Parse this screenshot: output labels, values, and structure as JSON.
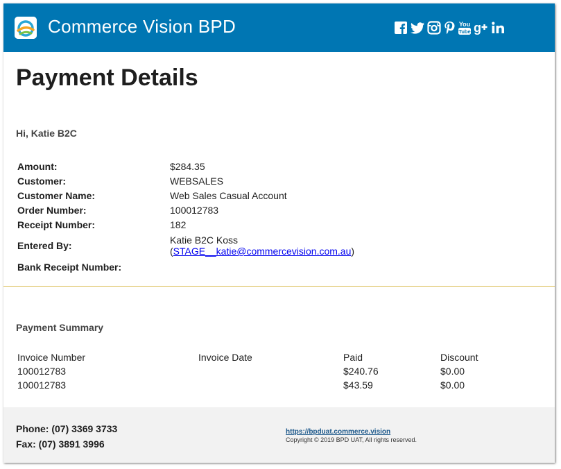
{
  "header": {
    "brand": "Commerce Vision BPD",
    "background": "#0076b3",
    "social_icons": [
      "facebook-icon",
      "twitter-icon",
      "instagram-icon",
      "pinterest-icon",
      "youtube-icon",
      "google-plus-icon",
      "linkedin-icon"
    ]
  },
  "page": {
    "title": "Payment Details",
    "greeting": "Hi, Katie B2C"
  },
  "details": {
    "amount_label": "Amount:",
    "amount_value": "$284.35",
    "customer_label": "Customer:",
    "customer_value": "WEBSALES",
    "customer_name_label": "Customer Name:",
    "customer_name_value": "Web Sales Casual Account",
    "order_number_label": "Order Number:",
    "order_number_value": "100012783",
    "receipt_number_label": "Receipt Number:",
    "receipt_number_value": "182",
    "entered_by_label": "Entered By:",
    "entered_by_name": "Katie B2C Koss",
    "entered_by_open": "(",
    "entered_by_email": "STAGE__katie@commercevision.com.au",
    "entered_by_close": ")",
    "bank_receipt_label": "Bank Receipt Number:",
    "bank_receipt_value": ""
  },
  "summary": {
    "title": "Payment Summary",
    "columns": [
      "Invoice Number",
      "Invoice Date",
      "Paid",
      "Discount"
    ],
    "rows": [
      {
        "invoice_number": "100012783",
        "invoice_date": "",
        "paid": "$240.76",
        "discount": "$0.00"
      },
      {
        "invoice_number": "100012783",
        "invoice_date": "",
        "paid": "$43.59",
        "discount": "$0.00"
      }
    ]
  },
  "footer": {
    "phone": "Phone: (07) 3369 3733",
    "fax": "Fax: (07) 3891 3996",
    "site": "https://bpduat.commerce.vision",
    "copyright": "Copyright © 2019 BPD UAT, All rights reserved."
  },
  "colors": {
    "header": "#0076b3",
    "divider": "#d9b94a",
    "footer": "#f2f2f2",
    "link": "#0000ee"
  }
}
